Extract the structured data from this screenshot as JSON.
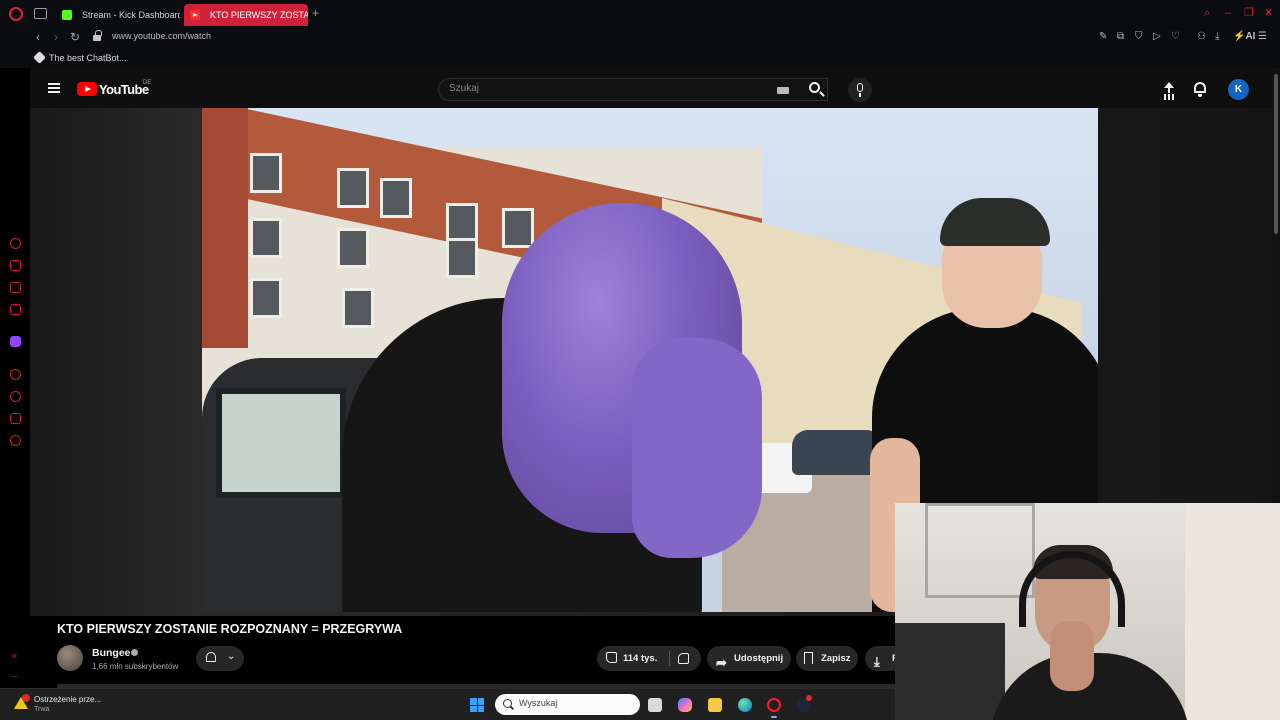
{
  "browser": {
    "tabs": [
      {
        "label": "Stream - Kick Dashboard",
        "active": false
      },
      {
        "label": "KTO PIERWSZY ZOSTA",
        "active": true
      }
    ],
    "url": "www.youtube.com/watch",
    "bookmark": "The best ChatBot...",
    "accent_color": "#d0213a",
    "ai_label": "AI"
  },
  "youtube": {
    "logo_text": "YouTube",
    "country_code": "DE",
    "search_placeholder": "Szukaj",
    "account_initial": "K",
    "video": {
      "title": "KTO PIERWSZY ZOSTANIE ROZPOZNANY = PRZEGRYWA",
      "channel": "Bungee",
      "subscribers": "1,66 mln subskrybentów",
      "likes": "114 tys.",
      "share_label": "Udostępnij",
      "save_label": "Zapisz",
      "download_label": "P"
    }
  },
  "taskbar": {
    "notification_title": "Ostrzeżenie prze...",
    "notification_sub": "Trwa",
    "search_placeholder": "Wyszukaj",
    "apps": [
      "file-manager",
      "copilot",
      "file-explorer",
      "edge",
      "opera-gx",
      "steam"
    ]
  }
}
